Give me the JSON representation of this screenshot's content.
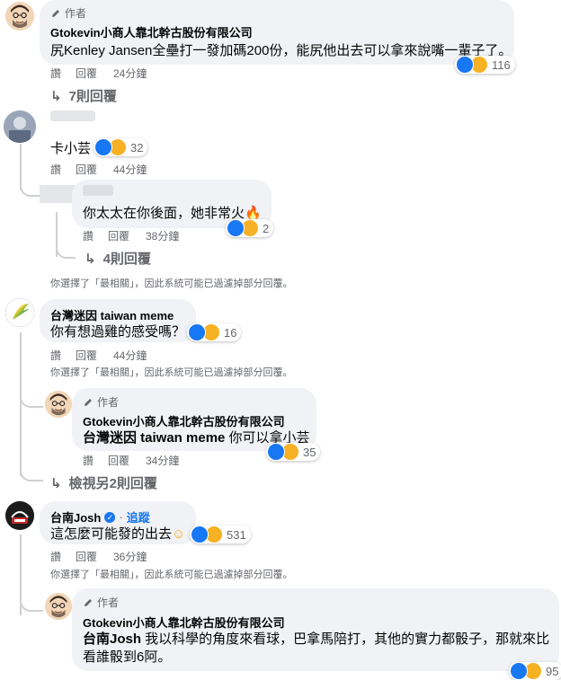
{
  "comments": [
    {
      "badge": "作者",
      "name": "Gtokevin小商人靠北幹古股份有限公司",
      "text": "尻Kenley Jansen全壘打一發加碼200份，能尻他出去可以拿來說嘴一輩子了。",
      "actions": [
        "讚",
        "回覆",
        "24分鐘"
      ],
      "reactions": "116",
      "replies_link": "7則回覆"
    },
    {
      "text": "卡小芸",
      "actions": [
        "讚",
        "回覆",
        "44分鐘"
      ],
      "reactions": "32"
    },
    {
      "text": "你太太在你後面，她非常火",
      "actions": [
        "讚",
        "回覆",
        "38分鐘"
      ],
      "reactions": "2",
      "replies_link": "4則回覆"
    },
    {
      "name": "台灣迷因 taiwan meme",
      "text": "你有想過雞的感受嗎？",
      "actions": [
        "讚",
        "回覆",
        "44分鐘"
      ],
      "reactions": "16"
    },
    {
      "badge": "作者",
      "name": "Gtokevin小商人靠北幹古股份有限公司",
      "mention": "台灣迷因 taiwan meme",
      "text": " 你可以拿小芸",
      "actions": [
        "讚",
        "回覆",
        "34分鐘"
      ],
      "reactions": "35",
      "replies_link": "檢視另2則回覆"
    },
    {
      "name": "台南Josh",
      "follow": "追蹤",
      "text": "這怎麼可能發的出去",
      "actions": [
        "讚",
        "回覆",
        "36分鐘"
      ],
      "reactions": "531"
    },
    {
      "badge": "作者",
      "name": "Gtokevin小商人靠北幹古股份有限公司",
      "mention": "台南Josh",
      "text_line1": " 我以科學的角度來看球，巴拿馬陪打，其他的實力都骰子，那就來比",
      "text_line2": "看誰骰到6阿。",
      "reactions": "95"
    }
  ],
  "filter_note": "你選擇了「最相關」，因此系統可能已過濾掉部分回覆。",
  "colors": {
    "accent": "#1877f2",
    "muted": "#65676b",
    "bubble": "#f0f2f5"
  }
}
